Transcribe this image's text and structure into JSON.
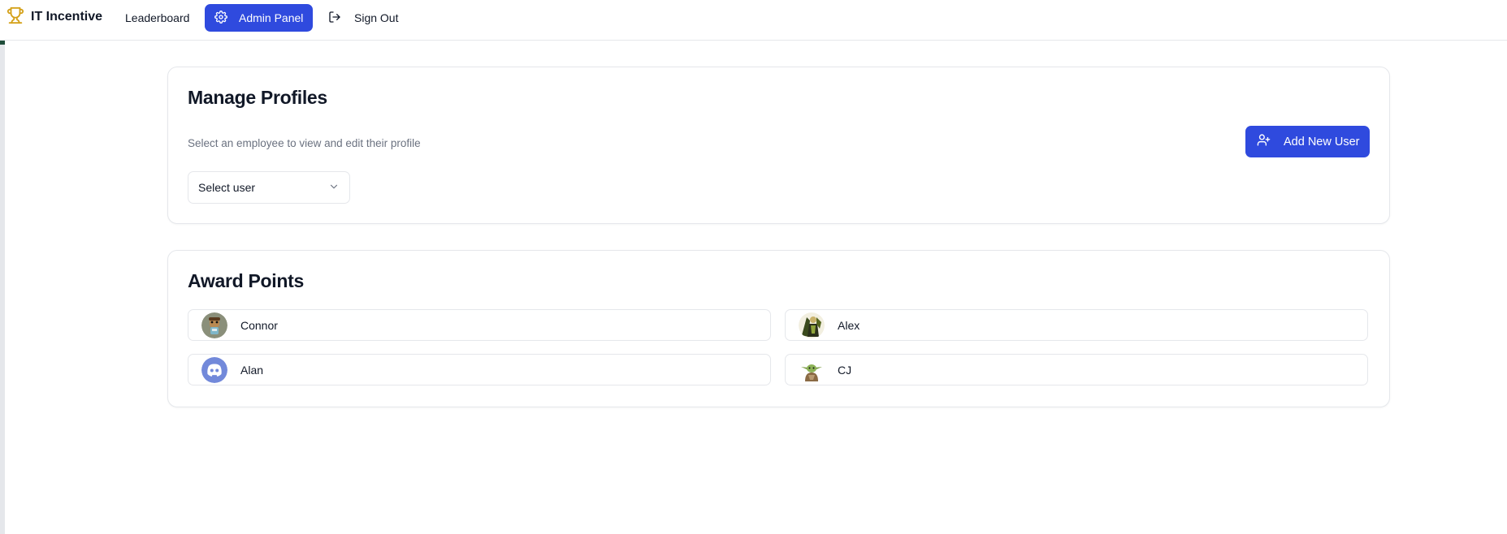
{
  "nav": {
    "brand": "IT Incentive",
    "leaderboard": "Leaderboard",
    "admin_panel": "Admin Panel",
    "sign_out": "Sign Out"
  },
  "profiles": {
    "title": "Manage Profiles",
    "subtitle": "Select an employee to view and edit their profile",
    "select_value": "Select user",
    "add_button": "Add New User"
  },
  "awards": {
    "title": "Award Points",
    "users": [
      {
        "name": "Connor",
        "avatar_icon": "cartoon-avatar-icon"
      },
      {
        "name": "Alex",
        "avatar_icon": "figure-avatar-icon"
      },
      {
        "name": "Alan",
        "avatar_icon": "discord-avatar-icon"
      },
      {
        "name": "CJ",
        "avatar_icon": "yoda-avatar-icon"
      }
    ]
  },
  "colors": {
    "accent": "#2f4ade",
    "brand_icon": "#d4a017",
    "border": "#e5e7eb",
    "muted_text": "#6b7280"
  }
}
